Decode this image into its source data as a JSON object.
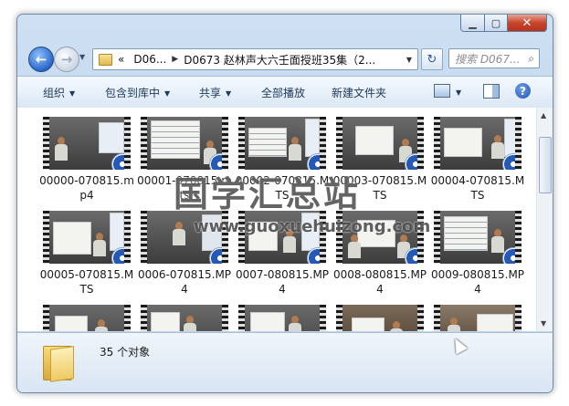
{
  "navbar": {
    "breadcrumb": [
      "«",
      "D06...",
      "D0673 赵林声大六壬面授班35集（2..."
    ],
    "search_placeholder": "搜索 D067..."
  },
  "toolbar": {
    "organize": "组织",
    "include_in_library": "包含到库中",
    "share": "共享",
    "play_all": "全部播放",
    "new_folder": "新建文件夹"
  },
  "files": [
    {
      "name": "00000-070815.mp4"
    },
    {
      "name": "00001-070815.mts"
    },
    {
      "name": "00002-070815.MTS"
    },
    {
      "name": "00003-070815.MTS"
    },
    {
      "name": "00004-070815.MTS"
    },
    {
      "name": "00005-070815.MTS"
    },
    {
      "name": "0006-070815.MP4"
    },
    {
      "name": "0007-080815.MP4"
    },
    {
      "name": "0008-080815.MP4"
    },
    {
      "name": "0009-080815.MP4"
    }
  ],
  "status": {
    "count_text": "35 个对象"
  },
  "watermark": {
    "title": "国学汇总站",
    "url": "www.guoxuehuizong.com"
  }
}
